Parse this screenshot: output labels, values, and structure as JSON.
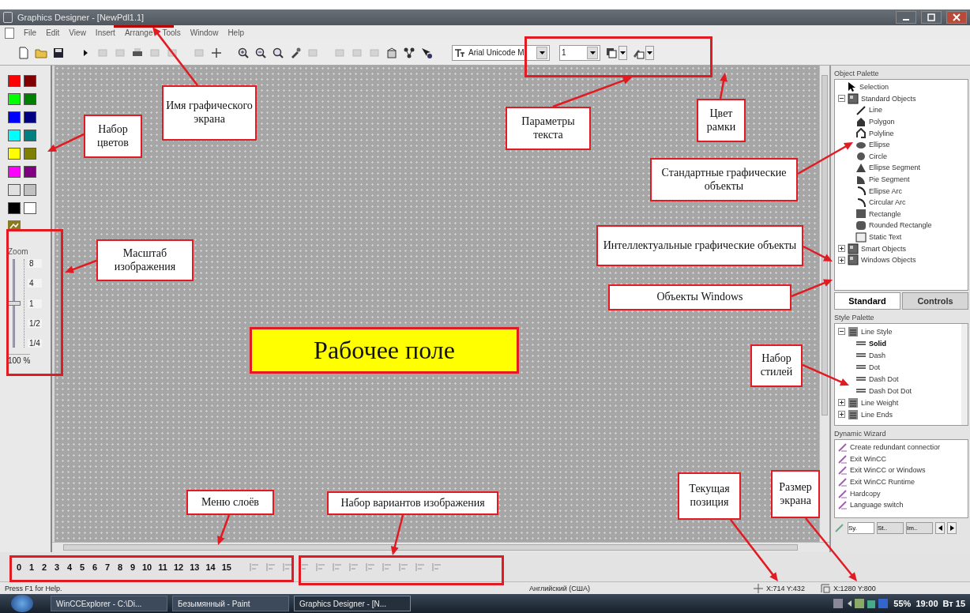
{
  "window": {
    "title": "Graphics Designer - [NewPdl1.1]"
  },
  "menu": [
    "File",
    "Edit",
    "View",
    "Insert",
    "Arrange",
    "Tools",
    "Window",
    "Help"
  ],
  "text_toolbar": {
    "font": "Arial Unicode M",
    "size": "1"
  },
  "colors": [
    {
      "color": "#ff0000"
    },
    {
      "color": "#800000"
    },
    {
      "color": "#00ff00"
    },
    {
      "color": "#008000"
    },
    {
      "color": "#0000ff"
    },
    {
      "color": "#000080"
    },
    {
      "color": "#00ffff"
    },
    {
      "color": "#008080"
    },
    {
      "color": "#ffff00"
    },
    {
      "color": "#808000"
    },
    {
      "color": "#ff00ff"
    },
    {
      "color": "#800080"
    },
    {
      "color": "#e0e0e0"
    },
    {
      "color": "#c0c0c0"
    },
    {
      "color": "#000000"
    },
    {
      "color": "#ffffff"
    }
  ],
  "zoom": {
    "label": "Zoom",
    "ticks": [
      "8",
      "4",
      "1",
      "1/2",
      "1/4"
    ],
    "level": 0.5,
    "reading": "100 %"
  },
  "object_palette": {
    "title": "Object Palette",
    "items": [
      {
        "label": "Selection"
      },
      {
        "label": "Standard Objects",
        "expanded": true,
        "children": [
          "Line",
          "Polygon",
          "Polyline",
          "Ellipse",
          "Circle",
          "Ellipse Segment",
          "Pie Segment",
          "Ellipse Arc",
          "Circular Arc",
          "Rectangle",
          "Rounded Rectangle",
          "Static Text"
        ]
      },
      {
        "label": "Smart Objects",
        "expanded": false
      },
      {
        "label": "Windows Objects",
        "expanded": false
      }
    ]
  },
  "palette_tabs": [
    {
      "label": "Standard",
      "selected": true
    },
    {
      "label": "Controls",
      "selected": false
    }
  ],
  "style_palette": {
    "title": "Style Palette",
    "items": [
      {
        "label": "Line Style",
        "expanded": true,
        "children": [
          {
            "label": "Solid",
            "selected": true
          },
          {
            "label": "Dash",
            "selected": false
          },
          {
            "label": "Dot",
            "selected": false
          },
          {
            "label": "Dash Dot",
            "selected": false
          },
          {
            "label": "Dash Dot Dot",
            "selected": false
          }
        ]
      },
      {
        "label": "Line Weight",
        "expanded": false
      },
      {
        "label": "Line Ends",
        "expanded": false
      }
    ]
  },
  "dynamic_wizard": {
    "title": "Dynamic Wizard",
    "items": [
      "Create redundant connectior",
      "Exit WinCC",
      "Exit WinCC or Windows",
      "Exit WinCC Runtime",
      "Hardcopy",
      "Language switch"
    ],
    "tabs": [
      {
        "label": "Sy.",
        "selected": true
      },
      {
        "label": "St..",
        "selected": false
      },
      {
        "label": "Im..",
        "selected": false
      }
    ]
  },
  "layers": [
    "0",
    "1",
    "2",
    "3",
    "4",
    "5",
    "6",
    "7",
    "8",
    "9",
    "10",
    "11",
    "12",
    "13",
    "14",
    "15"
  ],
  "status_bar": {
    "help": "Press F1 for Help.",
    "language": "Английский (США)",
    "position": "X:714 Y:432",
    "size": "X:1280 Y:800"
  },
  "taskbar": {
    "windows": [
      {
        "label": "WinCCExplorer - C:\\Di...",
        "selected": false
      },
      {
        "label": "Безымянный - Paint",
        "selected": false
      },
      {
        "label": "Graphics Designer - [N...",
        "selected": true
      }
    ],
    "battery": "55%",
    "clock": "19:00",
    "day": "Вт 15"
  },
  "work_area": {
    "label": "Рабочее поле"
  },
  "callouts": [
    "Имя графического экрана",
    "Набор цветов",
    "Параметры текста",
    "Цвет рамки",
    "Стандартные графические объекты",
    "Масштаб изображения",
    "Интеллектуальные графические объекты",
    "Объекты Windows",
    "Набор стилей",
    "Меню слоёв",
    "Набор вариантов изображения",
    "Текущая позиция",
    "Размер экрана"
  ]
}
